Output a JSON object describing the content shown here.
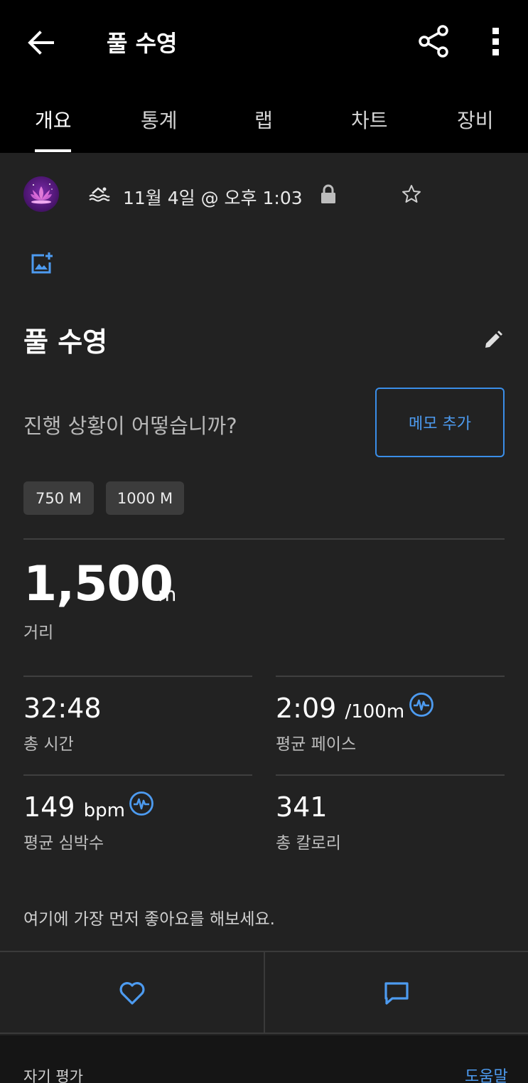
{
  "appbar": {
    "title": "풀 수영",
    "back_icon": "back-arrow-icon",
    "share_icon": "share-icon",
    "more_icon": "more-vert-icon"
  },
  "tabs": [
    {
      "label": "개요",
      "active": true
    },
    {
      "label": "통계",
      "active": false
    },
    {
      "label": "랩",
      "active": false
    },
    {
      "label": "차트",
      "active": false
    },
    {
      "label": "장비",
      "active": false
    }
  ],
  "activity": {
    "avatar_icon": "lotus-avatar-icon",
    "type_icon": "pool-swim-icon",
    "date": "11월 4일 @ 오후 1:03",
    "privacy_icon": "lock-icon",
    "favorite_icon": "star-outline-icon",
    "add_photo_icon": "add-photo-icon",
    "name": "풀 수영",
    "edit_icon": "pencil-icon",
    "prompt": "진행 상황이 어떻습니까?",
    "memo_button": "메모 추가"
  },
  "chips": [
    "750 M",
    "1000 M"
  ],
  "distance": {
    "value": "1,500",
    "unit": "m",
    "label": "거리"
  },
  "stats": {
    "total_time": {
      "value": "32:48",
      "label": "총 시간"
    },
    "avg_pace": {
      "value": "2:09",
      "unit": "/100m",
      "label": "평균 페이스"
    },
    "avg_hr": {
      "value": "149",
      "unit": "bpm",
      "label": "평균 심박수"
    },
    "calories": {
      "value": "341",
      "label": "총 칼로리"
    }
  },
  "social": {
    "likes_message": "여기에 가장 먼저 좋아요를 해보세요.",
    "like_icon": "heart-outline-icon",
    "comment_icon": "comment-icon"
  },
  "footer": {
    "self_evaluation": "자기 평가",
    "help": "도움말"
  },
  "colors": {
    "accent": "#4d9bf0",
    "background": "#222222",
    "bar": "#000000"
  }
}
